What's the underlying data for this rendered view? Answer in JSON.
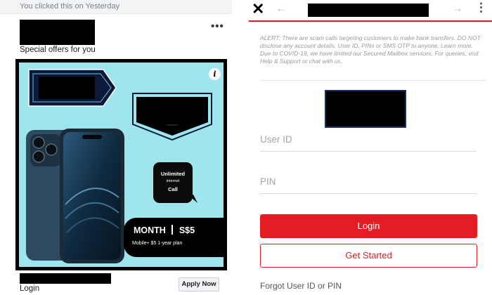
{
  "feed": {
    "activity_text": "You clicked this on Yesterday",
    "offer_caption": "Special offers for you",
    "more_icon": "more-horizontal-icon",
    "ad": {
      "info_icon_label": "i",
      "speech_line1": "Unlimited",
      "speech_line2": "internet",
      "speech_line3": "Call",
      "plan_label": "MONTH",
      "plan_price": "S$5",
      "plan_detail": "Mobile+ $5 1-year plan",
      "background_color": "#9fe5ee"
    },
    "footer_label": "Login",
    "cta_button": "Apply Now"
  },
  "bank_page": {
    "close_icon": "close-icon",
    "back_icon": "arrow-left-icon",
    "forward_icon": "arrow-right-icon",
    "menu_icon": "more-vertical-icon",
    "alert": "ALERT: There are scam calls targeting customers to make bank transfers. DO NOT disclose any account details, User ID, PINs or SMS OTP to anyone. Learn more. Due to COVID-19, we have limited our Secured Mailbox services. For queries, visit Help & Support or chat with us.",
    "user_id_placeholder": "User ID",
    "pin_placeholder": "PIN",
    "login_button": "Login",
    "get_started_button": "Get Started",
    "forgot_link": "Forgot User ID or PIN",
    "accent_color": "#e41d25"
  }
}
